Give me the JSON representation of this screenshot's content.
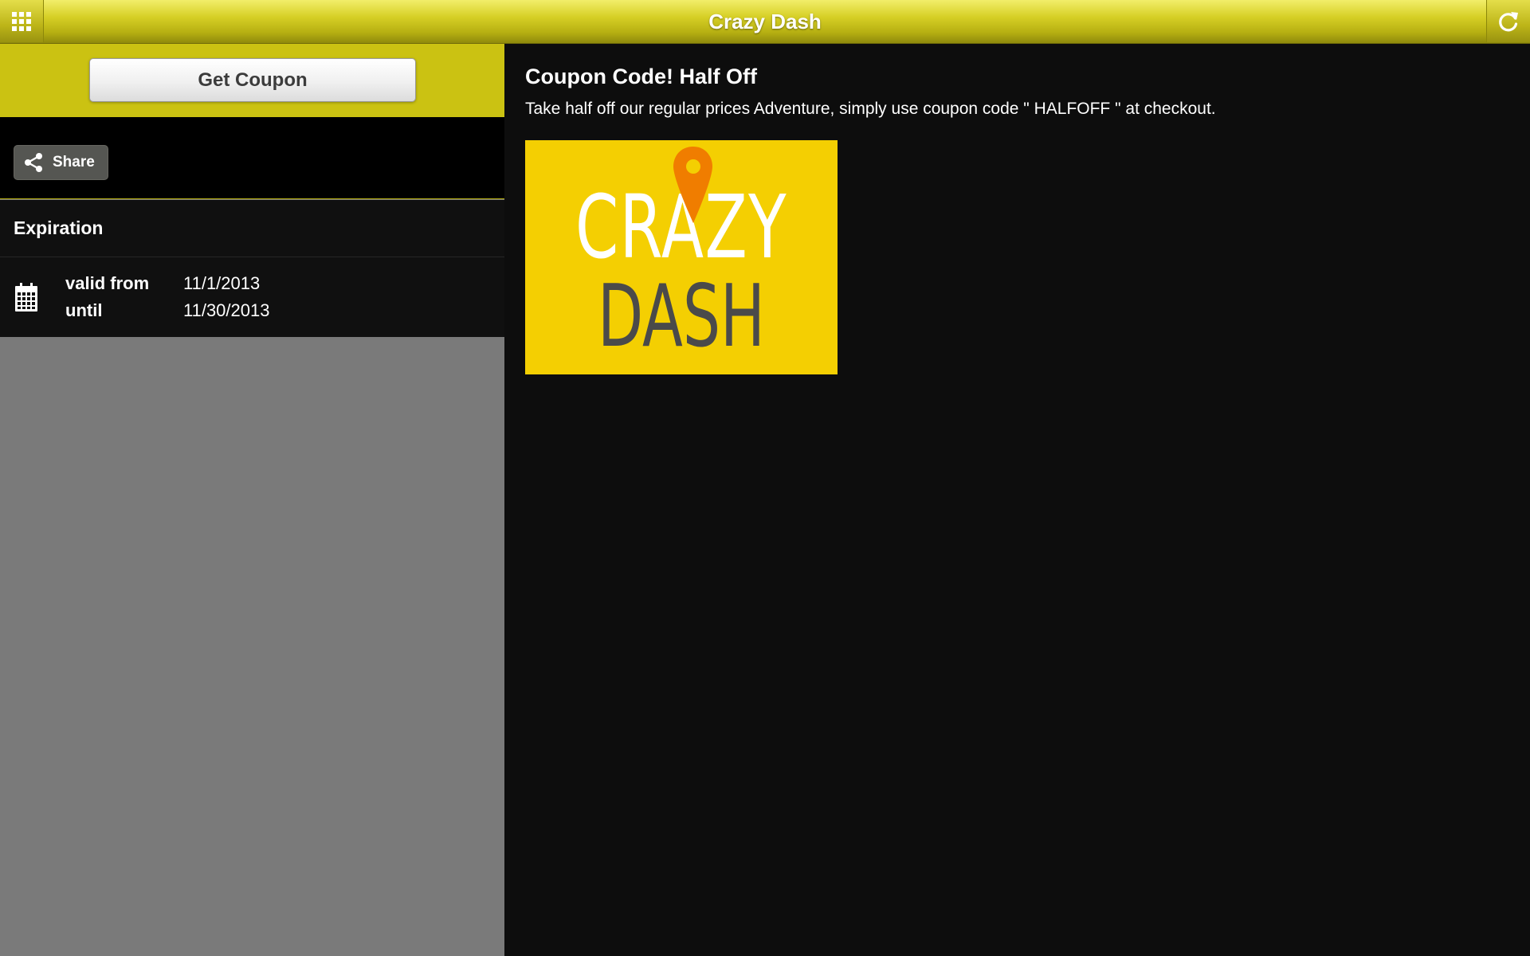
{
  "header": {
    "title": "Crazy Dash",
    "menu_icon": "grid-menu-icon",
    "refresh_icon": "refresh-icon"
  },
  "sidebar": {
    "get_coupon_label": "Get Coupon",
    "share_label": "Share",
    "share_icon": "share-icon",
    "expiration": {
      "heading": "Expiration",
      "icon": "calendar-icon",
      "from_label": "valid from",
      "from_value": "11/1/2013",
      "until_label": "until",
      "until_value": "11/30/2013"
    }
  },
  "coupon": {
    "title": "Coupon Code! Half Off",
    "description": "Take half off our regular prices Adventure, simply use coupon code \" HALFOFF \" at checkout.",
    "logo": {
      "line1": "CRAZY",
      "line2": "DASH",
      "icon": "map-pin-icon"
    }
  },
  "colors": {
    "header_yellow": "#d6cf25",
    "band_yellow": "#cbc212",
    "logo_yellow": "#f4cf02",
    "pin_orange": "#f07d00",
    "logo_dark_text": "#4a4a4a",
    "background_dark": "#0d0d0d",
    "sidebar_gray": "#7a7a7a"
  }
}
